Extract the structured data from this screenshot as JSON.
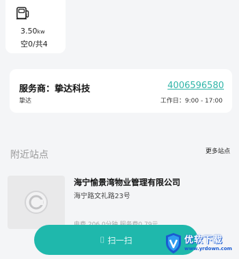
{
  "charger": {
    "icon": "charging-gun-icon",
    "power_value": "3.50",
    "power_unit": "kw",
    "availability": "空0/共4"
  },
  "provider": {
    "label": "服务商：挚达科技",
    "phone": "4006596580",
    "short_name": "挚达",
    "hours": "工作日：9:00 - 17:00"
  },
  "nearby": {
    "title": "附近站点",
    "more": "更多站点",
    "station": {
      "name": "海宁愉景湾物业管理有限公司",
      "address": "海宁路文礼路23号",
      "fees": "电费 206.0分钟      服务费0.79元",
      "logo_icon": "station-logo-icon"
    }
  },
  "scan_button": {
    "label": "扫一扫",
    "icon": "scan-icon"
  },
  "watermark": {
    "title": "优软下载",
    "url": "www.yrdown.com",
    "icon": "shield-v-icon"
  },
  "colors": {
    "accent": "#1fb8ac",
    "link": "#2fb5a8",
    "background": "#f4f5f7",
    "watermark_blue": "#1a5bd1"
  }
}
